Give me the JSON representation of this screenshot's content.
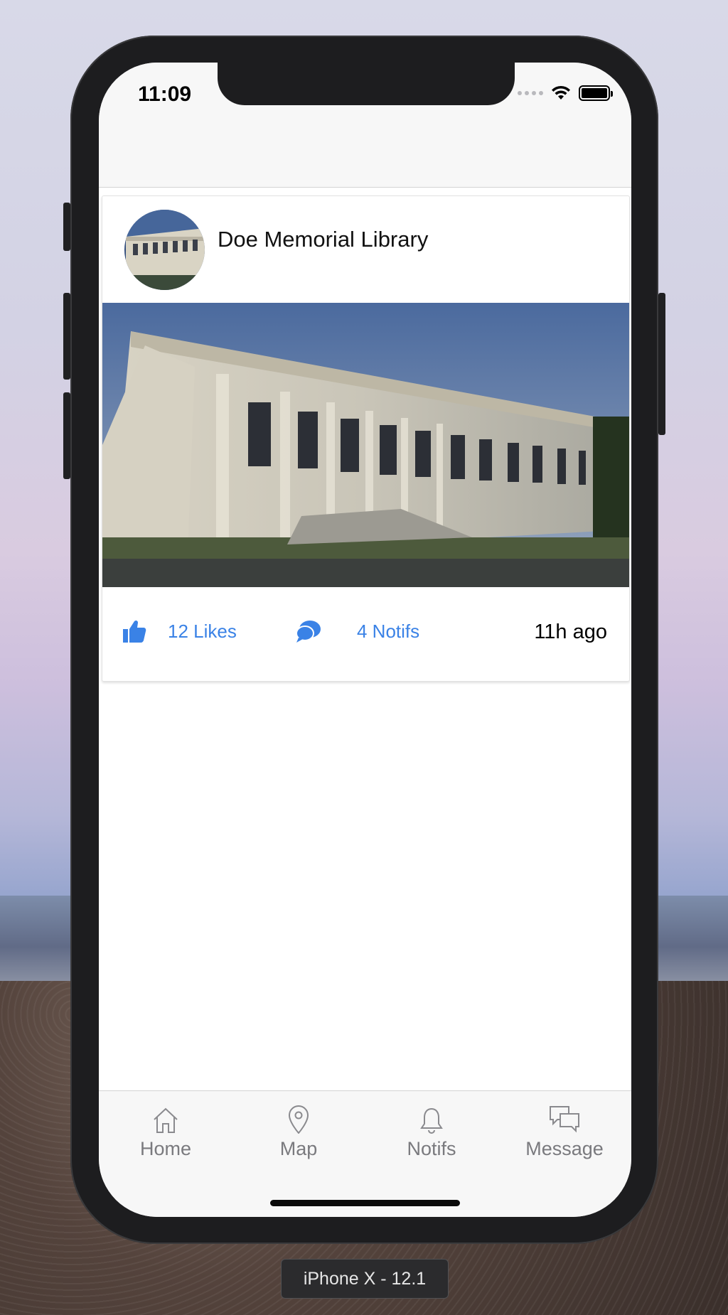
{
  "status": {
    "time": "11:09"
  },
  "card": {
    "title": "Doe Memorial Library",
    "likes": "12 Likes",
    "notifs": "4 Notifs",
    "time_ago": "11h ago",
    "accent_color": "#3a82e6"
  },
  "tabbar": {
    "items": [
      {
        "label": "Home",
        "icon": "home-icon"
      },
      {
        "label": "Map",
        "icon": "map-pin-icon"
      },
      {
        "label": "Notifs",
        "icon": "bell-icon"
      },
      {
        "label": "Message",
        "icon": "chat-bubbles-icon"
      }
    ]
  },
  "simulator": {
    "device_label": "iPhone X - 12.1"
  }
}
